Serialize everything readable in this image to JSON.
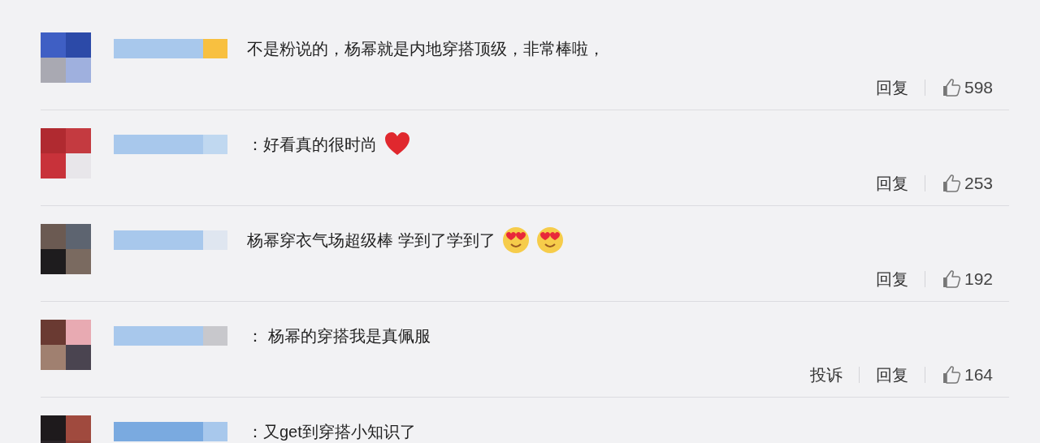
{
  "comments": [
    {
      "text": "不是粉说的，杨幂就是内地穿搭顶级，非常棒啦，",
      "actions": [
        "回复"
      ],
      "likes": "598"
    },
    {
      "text": "：好看真的很时尚",
      "icons": [
        {
          "kind": "heart"
        }
      ],
      "actions": [
        "回复"
      ],
      "likes": "253"
    },
    {
      "text": "杨幂穿衣气场超级棒 学到了学到了",
      "icons": [
        {
          "kind": "heart-eyes"
        },
        {
          "kind": "heart-eyes"
        }
      ],
      "actions": [
        "回复"
      ],
      "likes": "192"
    },
    {
      "text": "：  杨幂的穿搭我是真佩服",
      "actions": [
        "投诉",
        "回复"
      ],
      "likes": "164"
    },
    {
      "text": "：又get到穿搭小知识了"
    }
  ]
}
